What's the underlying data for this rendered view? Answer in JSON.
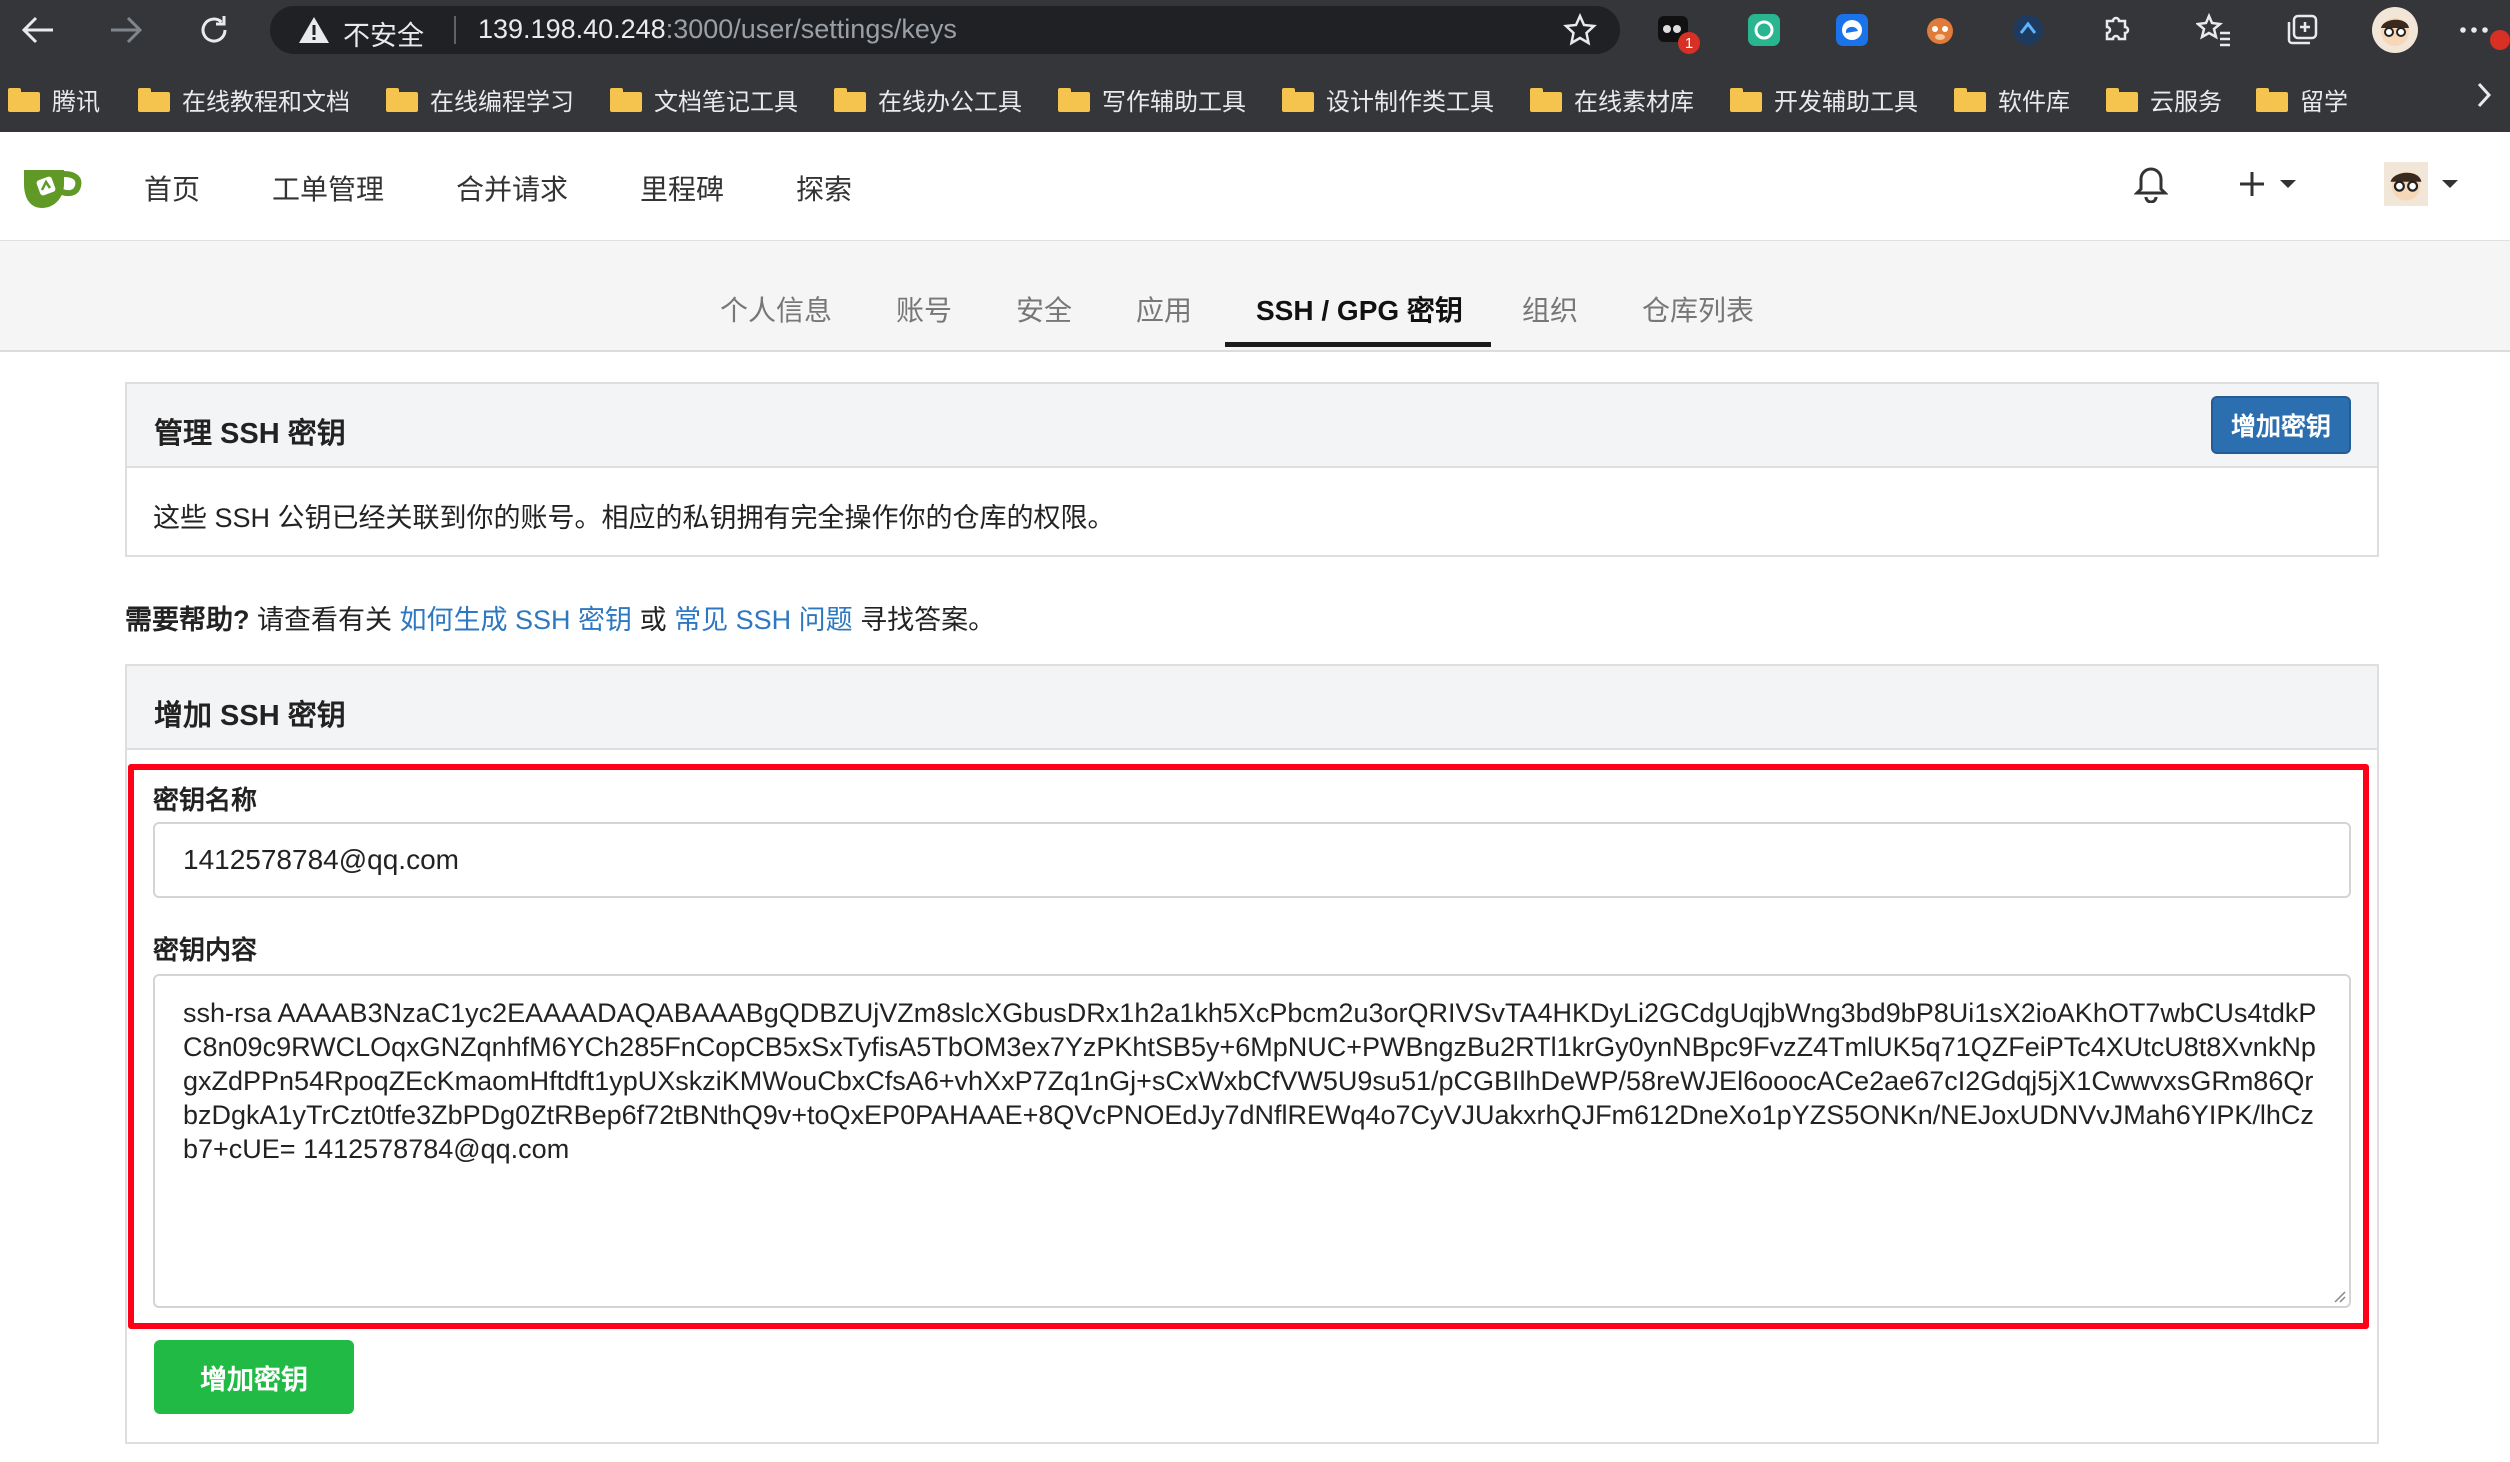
{
  "browser": {
    "insecure_label": "不安全",
    "url_host": "139.198.40.248",
    "url_path": ":3000/user/settings/keys",
    "extension_badge": "1",
    "bookmarks": [
      "腾讯",
      "在线教程和文档",
      "在线编程学习",
      "文档笔记工具",
      "在线办公工具",
      "写作辅助工具",
      "设计制作类工具",
      "在线素材库",
      "开发辅助工具",
      "软件库",
      "云服务",
      "留学"
    ]
  },
  "header": {
    "nav": [
      "首页",
      "工单管理",
      "合并请求",
      "里程碑",
      "探索"
    ]
  },
  "settings_tabs": [
    "个人信息",
    "账号",
    "安全",
    "应用",
    "SSH / GPG 密钥",
    "组织",
    "仓库列表"
  ],
  "manage_ssh": {
    "title": "管理 SSH 密钥",
    "add_button": "增加密钥",
    "description": "这些 SSH 公钥已经关联到你的账号。相应的私钥拥有完全操作你的仓库的权限。"
  },
  "help": {
    "prefix": "需要帮助?",
    "text1": "请查看有关",
    "link1": "如何生成 SSH 密钥",
    "text2": "或",
    "link2": "常见 SSH 问题",
    "text3": "寻找答案。"
  },
  "add_ssh": {
    "title": "增加 SSH 密钥",
    "name_label": "密钥名称",
    "name_value": "1412578784@qq.com",
    "content_label": "密钥内容",
    "content_value": "ssh-rsa AAAAB3NzaC1yc2EAAAADAQABAAABgQDBZUjVZm8slcXGbusDRx1h2a1kh5XcPbcm2u3orQRIVSvTA4HKDyLi2GCdgUqjbWng3bd9bP8Ui1sX2ioAKhOT7wbCUs4tdkPC8n09c9RWCLOqxGNZqnhfM6YCh285FnCopCB5xSxTyfisA5TbOM3ex7YzPKhtSB5y+6MpNUC+PWBngzBu2RTl1krGy0ynNBpc9FvzZ4TmlUK5q71QZFeiPTc4XUtcU8t8XvnkNpgxZdPPn54RpoqZEcKmaomHftdft1ypUXskziKMWouCbxCfsA6+vhXxP7Zq1nGj+sCxWxbCfVW5U9su51/pCGBIlhDeWP/58reWJEl6ooocACe2ae67cI2Gdqj5jX1CwwvxsGRm86QrbzDgkA1yTrCzt0tfe3ZbPDg0ZtRBep6f72tBNthQ9v+toQxEP0PAHAAE+8QVcPNOEdJy7dNflREWq4o7CyVJUakxrhQJFm612DneXo1pYZS5ONKn/NEJoxUDNVvJMah6YIPK/lhCzb7+cUE= 1412578784@qq.com",
    "submit_button": "增加密钥"
  }
}
